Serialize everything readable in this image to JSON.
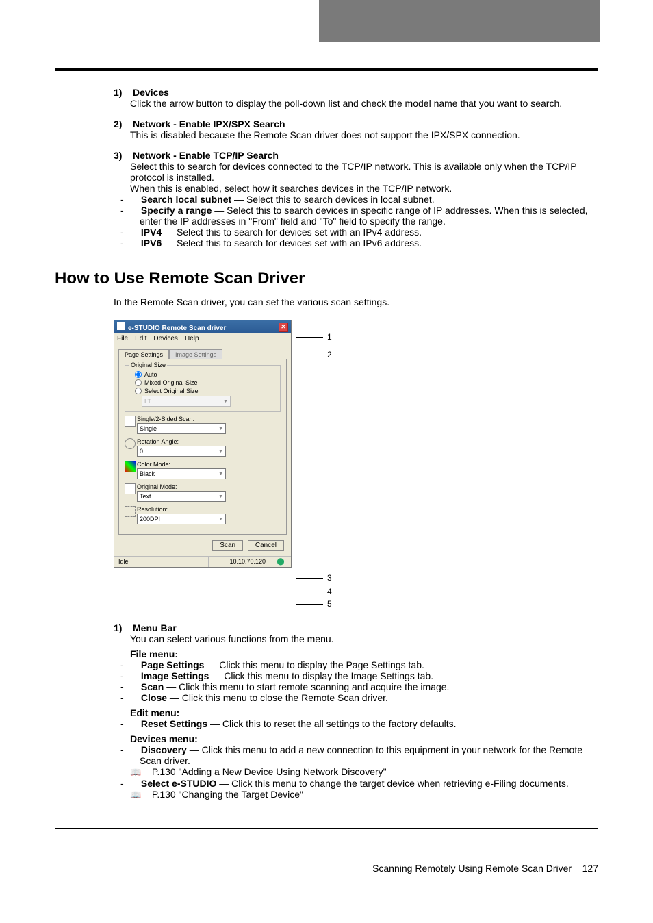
{
  "items": {
    "devices": {
      "num": "1)",
      "title": "Devices",
      "body": "Click the arrow button to display the poll-down list and check the model name that you want to search."
    },
    "ipx": {
      "num": "2)",
      "title": "Network - Enable IPX/SPX Search",
      "body": "This is disabled because the Remote Scan driver does not support the IPX/SPX connection."
    },
    "tcpip": {
      "num": "3)",
      "title": "Network - Enable TCP/IP Search",
      "body1": "Select this to search for devices connected to the TCP/IP network.  This is available only when the TCP/IP protocol is installed.",
      "body2": "When this is enabled, select how it searches devices in the TCP/IP network.",
      "sub": {
        "a_label": "Search local subnet",
        "a_rest": " — Select this to search devices in local subnet.",
        "b_label": "Specify a range",
        "b_rest": " — Select this to search devices in specific range of IP addresses. When this is selected, enter the IP addresses in \"From\" field and \"To\" field to specify the range.",
        "c_label": "IPV4",
        "c_rest": " — Select this to search for devices set with an IPv4 address.",
        "d_label": "IPV6",
        "d_rest": " — Select this to search for devices set with an IPv6 address."
      }
    }
  },
  "section_title": "How to Use Remote Scan Driver",
  "intro": "In the Remote Scan driver, you can set the various scan settings.",
  "screenshot": {
    "title": "e-STUDIO Remote Scan driver",
    "menu": {
      "file": "File",
      "edit": "Edit",
      "devices": "Devices",
      "help": "Help"
    },
    "tabs": {
      "page": "Page Settings",
      "image": "Image Settings"
    },
    "original_size": {
      "group": "Original Size",
      "auto": "Auto",
      "mixed": "Mixed Original Size",
      "select": "Select Original Size",
      "dd": "LT"
    },
    "fields": {
      "single_label": "Single/2-Sided Scan:",
      "single_val": "Single",
      "rotation_label": "Rotation Angle:",
      "rotation_val": "0",
      "color_label": "Color Mode:",
      "color_val": "Black",
      "origmode_label": "Original Mode:",
      "origmode_val": "Text",
      "resolution_label": "Resolution:",
      "resolution_val": "200DPI"
    },
    "buttons": {
      "scan": "Scan",
      "cancel": "Cancel"
    },
    "status": {
      "idle": "Idle",
      "ip": "10.10.70.120"
    }
  },
  "callouts": {
    "c1": "1",
    "c2": "2",
    "c3": "3",
    "c4": "4",
    "c5": "5"
  },
  "menu_bar": {
    "num": "1)",
    "title": "Menu Bar",
    "body": "You can select various functions from the menu.",
    "file_menu_title": "File menu:",
    "file": {
      "ps_label": "Page Settings",
      "ps_rest": " — Click this menu to display the Page Settings tab.",
      "is_label": "Image Settings",
      "is_rest": " — Click this menu to display the Image Settings tab.",
      "scan_label": "Scan",
      "scan_rest": " — Click this menu to start remote scanning and acquire the image.",
      "close_label": "Close",
      "close_rest": " — Click this menu to close the Remote Scan driver."
    },
    "edit_menu_title": "Edit menu:",
    "edit": {
      "reset_label": "Reset Settings",
      "reset_rest": " — Click this to reset the all settings to the factory defaults."
    },
    "devices_menu_title": "Devices menu:",
    "devices": {
      "disc_label": "Discovery",
      "disc_rest": " — Click this menu to add a new connection to this equipment in your network for the Remote Scan driver.",
      "disc_ref": " P.130 \"Adding a New Device Using Network Discovery\"",
      "sel_label": "Select e-STUDIO",
      "sel_rest": " — Click this menu to change the target device when retrieving e-Filing documents.",
      "sel_ref": " P.130 \"Changing the Target Device\""
    }
  },
  "footer": {
    "text": "Scanning Remotely Using Remote Scan Driver",
    "page": "127"
  }
}
